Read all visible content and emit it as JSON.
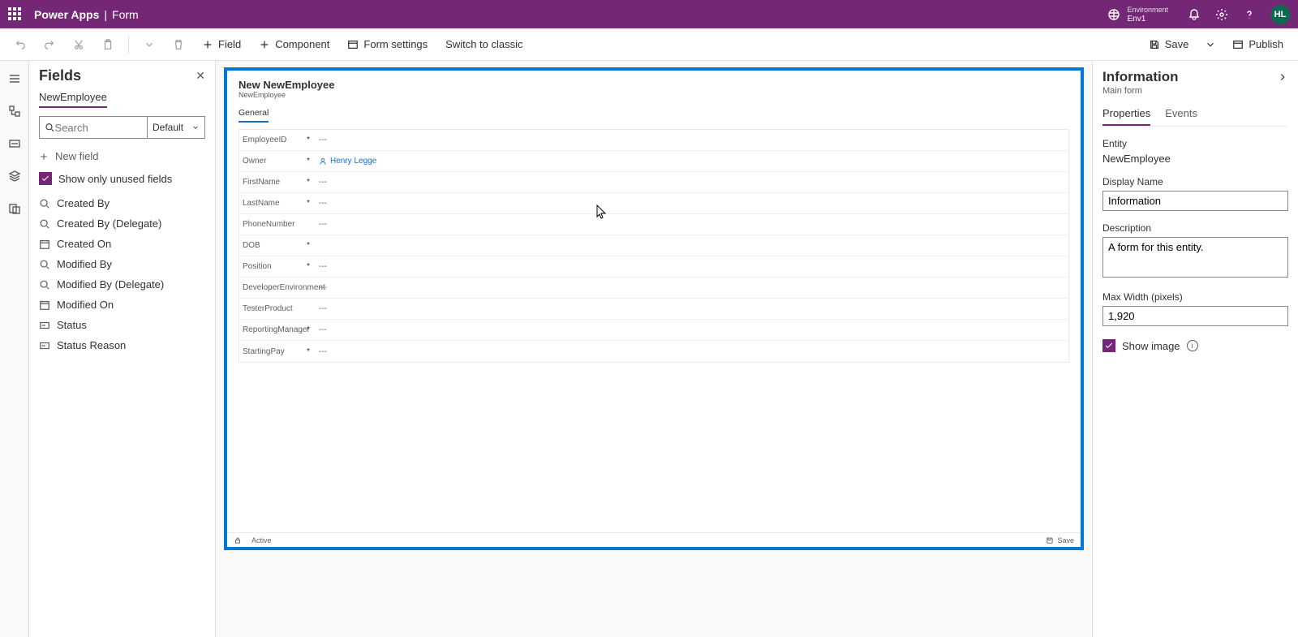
{
  "header": {
    "app": "Power Apps",
    "section": "Form",
    "env_label": "Environment",
    "env_name": "Env1",
    "avatar": "HL"
  },
  "cmd": {
    "field": "Field",
    "component": "Component",
    "form_settings": "Form settings",
    "switch_classic": "Switch to classic",
    "save": "Save",
    "publish": "Publish"
  },
  "fields_panel": {
    "title": "Fields",
    "entity": "NewEmployee",
    "search_placeholder": "Search",
    "filter": "Default",
    "new_field": "New field",
    "unused_label": "Show only unused fields",
    "items": [
      {
        "label": "Created By",
        "icon": "lookup"
      },
      {
        "label": "Created By (Delegate)",
        "icon": "lookup"
      },
      {
        "label": "Created On",
        "icon": "datetime"
      },
      {
        "label": "Modified By",
        "icon": "lookup"
      },
      {
        "label": "Modified By (Delegate)",
        "icon": "lookup"
      },
      {
        "label": "Modified On",
        "icon": "datetime"
      },
      {
        "label": "Status",
        "icon": "option"
      },
      {
        "label": "Status Reason",
        "icon": "option"
      }
    ]
  },
  "form": {
    "title": "New NewEmployee",
    "subtitle": "NewEmployee",
    "tab": "General",
    "rows": [
      {
        "label": "EmployeeID",
        "req": "*",
        "value": "---"
      },
      {
        "label": "Owner",
        "req": "*",
        "value": "Henry Legge",
        "owner": true
      },
      {
        "label": "FirstName",
        "req": "*",
        "value": "---"
      },
      {
        "label": "LastName",
        "req": "*",
        "value": "---"
      },
      {
        "label": "PhoneNumber",
        "req": "",
        "value": "---"
      },
      {
        "label": "DOB",
        "req": "*",
        "value": ""
      },
      {
        "label": "Position",
        "req": "*",
        "value": "---"
      },
      {
        "label": "DeveloperEnvironment",
        "req": "",
        "value": "---"
      },
      {
        "label": "TesterProduct",
        "req": "",
        "value": "---"
      },
      {
        "label": "ReportingManager",
        "req": "*",
        "value": "---"
      },
      {
        "label": "StartingPay",
        "req": "*",
        "value": "---"
      }
    ],
    "footer_status": "Active",
    "footer_save": "Save"
  },
  "props": {
    "title": "Information",
    "subtitle": "Main form",
    "tab_props": "Properties",
    "tab_events": "Events",
    "entity_lbl": "Entity",
    "entity_val": "NewEmployee",
    "display_lbl": "Display Name",
    "display_val": "Information",
    "desc_lbl": "Description",
    "desc_val": "A form for this entity.",
    "maxw_lbl": "Max Width (pixels)",
    "maxw_val": "1,920",
    "show_image": "Show image"
  }
}
